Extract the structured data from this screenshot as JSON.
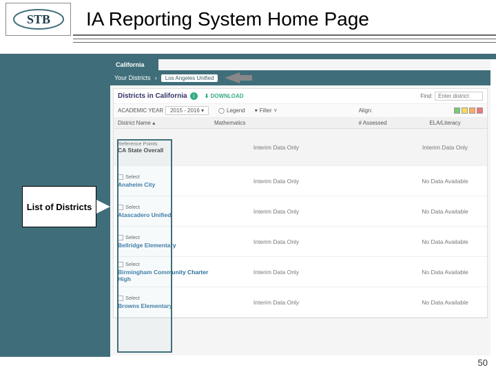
{
  "slide": {
    "title": "IA Reporting System Home Page",
    "page_number": "50",
    "callout_label": "List of Districts"
  },
  "app": {
    "state_tab": "California",
    "your_districts_label": "Your Districts",
    "district_chip": "Los Angeles Unified",
    "panel_title": "Districts in California",
    "info_icon": "i",
    "download_label": "DOWNLOAD",
    "find_label": "Find:",
    "find_placeholder": "Enter district",
    "toolbar": {
      "academic_year_label": "ACADEMIC YEAR",
      "academic_year_value": "2015 - 2016",
      "legend_label": "Legend",
      "filter_label": "Filter",
      "align_label": "Align:"
    },
    "columns": {
      "c1": "District Name",
      "c2": "Mathematics",
      "c3": "# Assessed",
      "c4": "ELA/Literacy"
    },
    "reference_label": "Reference Points",
    "rows": [
      {
        "name": "CA State Overall",
        "ref": true,
        "interim": "Interim Data Only",
        "ela": "Interim Data Only"
      },
      {
        "name": "Anaheim City",
        "interim": "Interim Data Only",
        "ela": "No Data Available"
      },
      {
        "name": "Atascadero Unified",
        "interim": "Interim Data Only",
        "ela": "No Data Available"
      },
      {
        "name": "Bellridge Elementary",
        "interim": "Interim Data Only",
        "ela": "No Data Available"
      },
      {
        "name": "Birmingham Community Charter High",
        "interim": "Interim Data Only",
        "ela": "No Data Available"
      },
      {
        "name": "Browns Elementary",
        "interim": "Interim Data Only",
        "ela": "No Data Available"
      }
    ],
    "select_label": "Select"
  }
}
